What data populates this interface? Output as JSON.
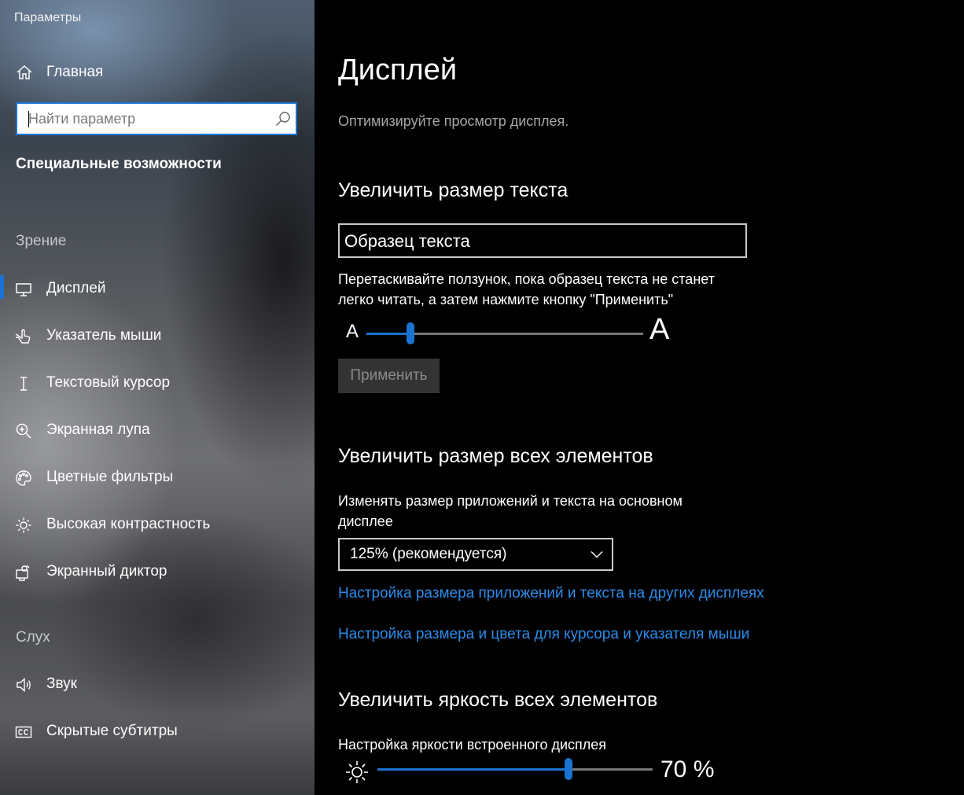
{
  "window": {
    "title": "Параметры"
  },
  "sidebar": {
    "home_label": "Главная",
    "search": {
      "placeholder": "Найти параметр",
      "value": ""
    },
    "section_title": "Специальные возможности",
    "groups": [
      {
        "header": "Зрение",
        "items": [
          {
            "label": "Дисплей",
            "icon": "monitor-icon",
            "active": true
          },
          {
            "label": "Указатель мыши",
            "icon": "mouse-pointer-icon"
          },
          {
            "label": "Текстовый курсор",
            "icon": "text-cursor-icon"
          },
          {
            "label": "Экранная лупа",
            "icon": "magnifier-icon"
          },
          {
            "label": "Цветные фильтры",
            "icon": "color-palette-icon"
          },
          {
            "label": "Высокая контрастность",
            "icon": "brightness-icon"
          },
          {
            "label": "Экранный диктор",
            "icon": "narrator-icon"
          }
        ]
      },
      {
        "header": "Слух",
        "items": [
          {
            "label": "Звук",
            "icon": "speaker-icon"
          },
          {
            "label": "Скрытые субтитры",
            "icon": "closed-captions-icon"
          }
        ]
      }
    ]
  },
  "main": {
    "title": "Дисплей",
    "description": "Оптимизируйте просмотр дисплея.",
    "text_size": {
      "heading": "Увеличить размер текста",
      "sample_text": "Образец текста",
      "instructions_line1": "Перетаскивайте ползунок, пока образец текста не станет",
      "instructions_line2": "легко читать, а затем нажмите кнопку \"Применить\"",
      "small_label": "A",
      "large_label": "A",
      "slider_value_fraction": 0.15,
      "apply_label": "Применить"
    },
    "scale": {
      "heading": "Увеличить размер всех элементов",
      "label_line1": "Изменять размер приложений и текста на основном",
      "label_line2": "дисплее",
      "selected": "125% (рекомендуется)",
      "link_other_displays": "Настройка размера приложений и текста на других дисплеях",
      "link_cursor": "Настройка размера и цвета для курсора и указателя мыши"
    },
    "brightness": {
      "heading": "Увеличить яркость всех элементов",
      "label": "Настройка яркости встроенного дисплея",
      "value": 70,
      "value_text": "70 %"
    }
  },
  "colors": {
    "accent": "#1a73d1",
    "link": "#2b8be8",
    "background": "#000000"
  }
}
